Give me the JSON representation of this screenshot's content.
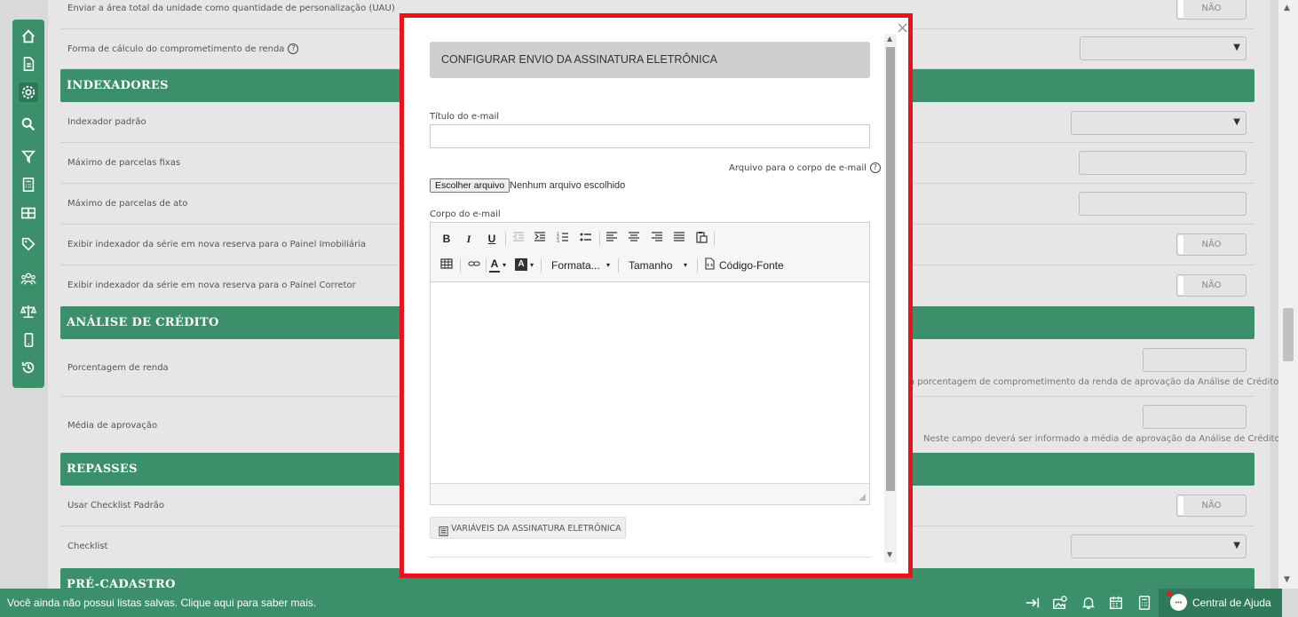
{
  "form": {
    "row_uau_label": "Enviar a área total da unidade como quantidade de personalização (UAU)",
    "row_calc_label": "Forma de cálculo do comprometimento de renda",
    "section_indexadores": "INDEXADORES",
    "row_indexador_label": "Indexador padrão",
    "row_parcelas_fixas_label": "Máximo de parcelas fixas",
    "row_parcelas_ato_label": "Máximo de parcelas de ato",
    "row_exibir_imob_label": "Exibir indexador da série em nova reserva para o Painel Imobiliária",
    "row_exibir_corretor_label": "Exibir indexador da série em nova reserva para o Painel Corretor",
    "section_analise": "ANÁLISE DE CRÉDITO",
    "row_porcentagem_label": "Porcentagem de renda",
    "row_porcentagem_hint": "a porcentagem de comprometimento da renda de aprovação da Análise de Crédito.",
    "row_media_label": "Média de aprovação",
    "row_media_hint": "Neste campo deverá ser informado a média de aprovação da Análise de Crédito.",
    "section_repasses": "REPASSES",
    "row_checklist_padrao_label": "Usar Checklist Padrão",
    "row_checklist_label": "Checklist",
    "section_precadastro": "PRÉ-CADASTRO",
    "toggle_off_label": "NÃO",
    "help_glyph": "?"
  },
  "modal": {
    "close_glyph": "×",
    "title": "CONFIGURAR ENVIO DA ASSINATURA ELETRÔNICA",
    "email_title_label": "Título do e-mail",
    "email_title_value": "",
    "attachment_label": "Arquivo para o corpo de e-mail",
    "file_button_label": "Escolher arquivo",
    "file_status": "Nenhum arquivo escolhido",
    "body_label": "Corpo do e-mail",
    "toolbar": {
      "bold": "B",
      "italic": "I",
      "underline": "U",
      "format_label": "Formata...",
      "size_label": "Tamanho",
      "source_label": "Código-Fonte",
      "text_color_glyph": "A",
      "bg_color_glyph": "A",
      "dropdown_glyph": "▾"
    },
    "variables_button": "VARIÁVEIS DA ASSINATURA ELETRÔNICA"
  },
  "bottom_bar": {
    "message": "Você ainda não possui listas salvas. Clique aqui para saber mais.",
    "help_center_label": "Central de Ajuda"
  },
  "colors": {
    "accent_green": "#3b8f6b",
    "modal_border": "#e8141c"
  }
}
